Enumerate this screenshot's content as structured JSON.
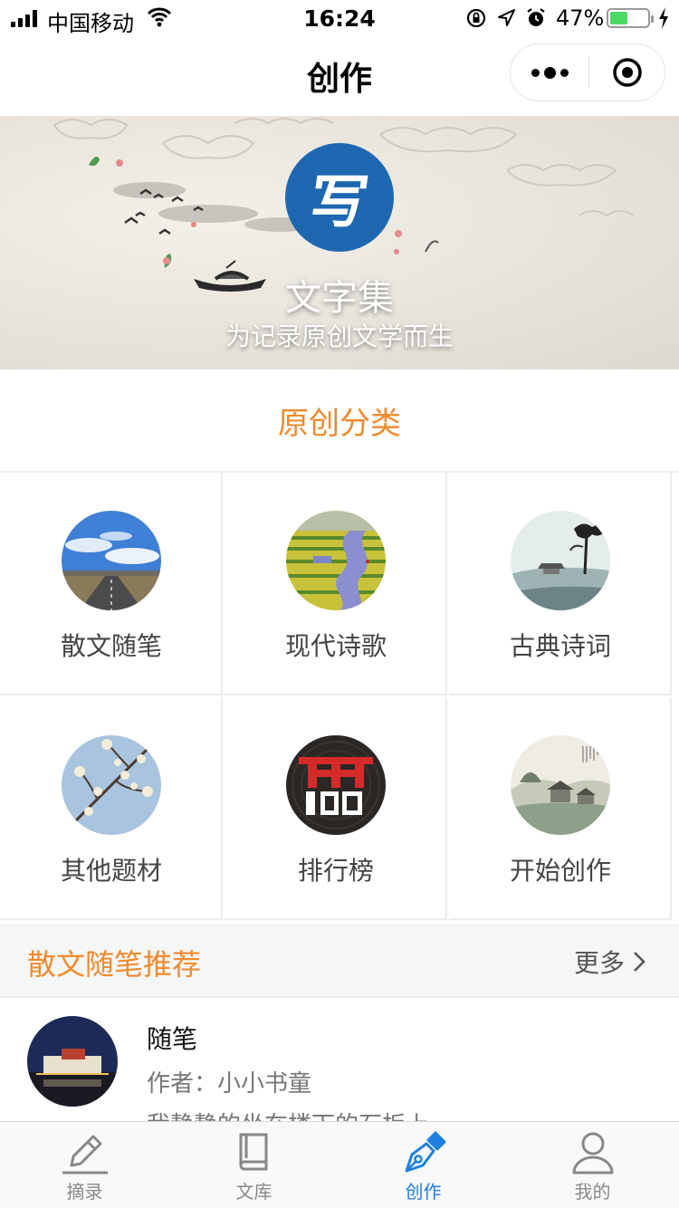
{
  "status_bar": {
    "carrier": "中国移动",
    "time": "16:24",
    "battery_percent_text": "47%",
    "battery_level": 0.47,
    "battery_color": "#4cd964"
  },
  "nav": {
    "title": "创作",
    "more_icon": "more-dots-icon",
    "close_icon": "target-close-icon"
  },
  "banner": {
    "logo_char": "写",
    "logo_color": "#1d68b1",
    "brand_name": "文字集",
    "slogan": "为记录原创文学而生"
  },
  "categories": {
    "title": "原创分类",
    "accent": "#f08a2e",
    "items": [
      {
        "label": "散文随笔",
        "image": "road-sky-photo"
      },
      {
        "label": "现代诗歌",
        "image": "canola-fields-river-photo"
      },
      {
        "label": "古典诗词",
        "image": "ink-painting-pavilion-photo"
      },
      {
        "label": "其他题材",
        "image": "magnolia-branch-photo"
      },
      {
        "label": "排行榜",
        "image": "top100-record-icon"
      },
      {
        "label": "开始创作",
        "image": "ink-village-painting-photo"
      }
    ]
  },
  "recommend": {
    "title": "散文随笔推荐",
    "more_label": "更多",
    "articles": [
      {
        "title": "随笔",
        "author": "作者：小小书童",
        "excerpt": "我静静的坐在楼下的石板上"
      }
    ]
  },
  "tabbar": {
    "active_color": "#1e80e0",
    "items": [
      {
        "label": "摘录",
        "icon": "pencil-icon"
      },
      {
        "label": "文库",
        "icon": "book-icon"
      },
      {
        "label": "创作",
        "icon": "pen-nib-icon",
        "active": true
      },
      {
        "label": "我的",
        "icon": "user-icon"
      }
    ]
  }
}
